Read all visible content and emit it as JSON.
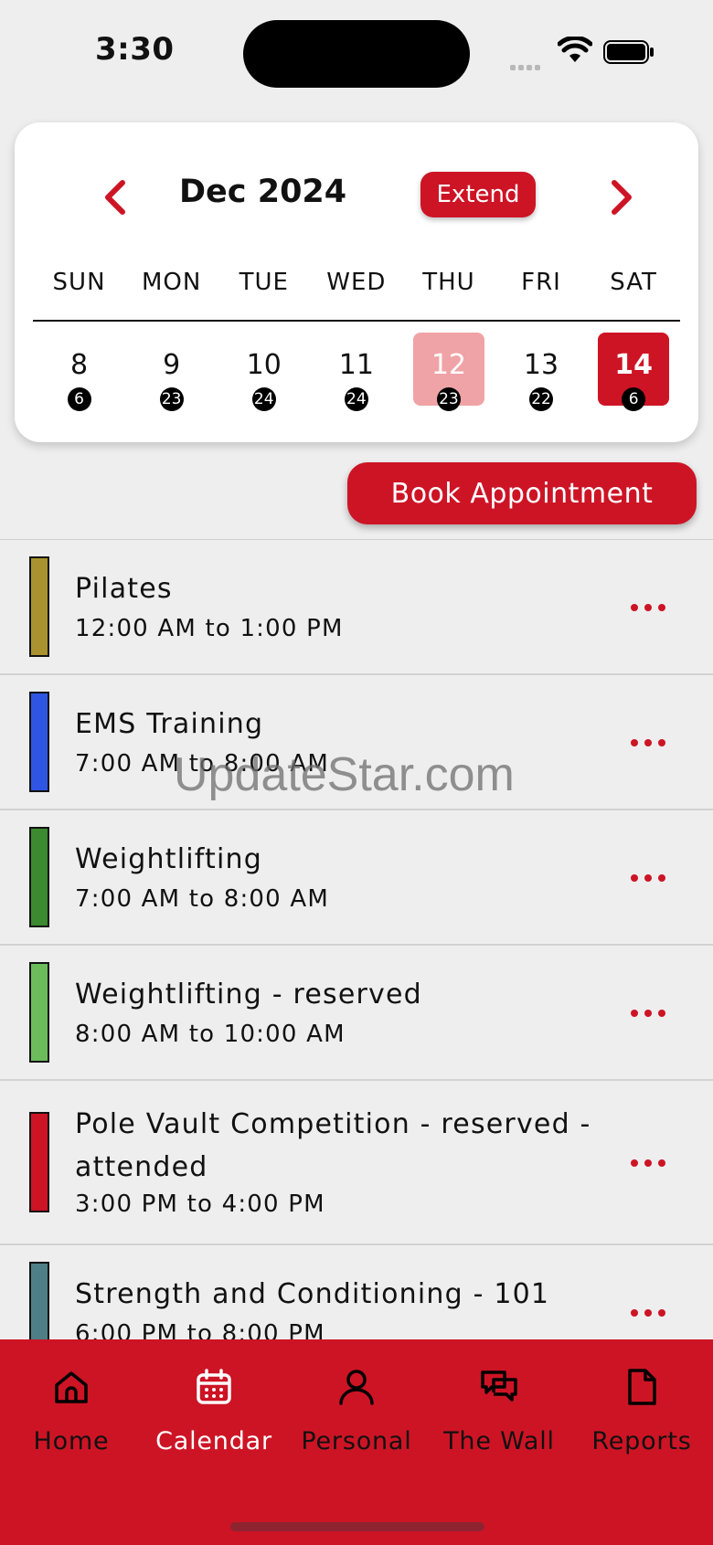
{
  "status_bar": {
    "time": "3:30"
  },
  "calendar": {
    "month_title": "Dec 2024",
    "extend_label": "Extend",
    "weekdays": [
      "SUN",
      "MON",
      "TUE",
      "WED",
      "THU",
      "FRI",
      "SAT"
    ],
    "days": [
      {
        "num": "8",
        "count": "6",
        "state": "normal"
      },
      {
        "num": "9",
        "count": "23",
        "state": "normal"
      },
      {
        "num": "10",
        "count": "24",
        "state": "normal"
      },
      {
        "num": "11",
        "count": "24",
        "state": "normal"
      },
      {
        "num": "12",
        "count": "23",
        "state": "today"
      },
      {
        "num": "13",
        "count": "22",
        "state": "normal"
      },
      {
        "num": "14",
        "count": "6",
        "state": "selected"
      }
    ],
    "colors": {
      "accent": "#cd1425",
      "today_highlight": "#f0a3a6"
    }
  },
  "book_button_label": "Book Appointment",
  "appointments": [
    {
      "title": "Pilates",
      "time": "12:00 AM to 1:00 PM",
      "color": "#a9922f"
    },
    {
      "title": "EMS Training",
      "time": "7:00 AM to 8:00 AM",
      "color": "#2f55e3"
    },
    {
      "title": "Weightlifting",
      "time": "7:00 AM to 8:00 AM",
      "color": "#3b8a30"
    },
    {
      "title": "Weightlifting - reserved",
      "time": "8:00 AM to 10:00 AM",
      "color": "#6cbc5c"
    },
    {
      "title": "Pole Vault Competition - reserved - attended",
      "time": "3:00 PM to 4:00 PM",
      "color": "#cd1425"
    },
    {
      "title": "Strength and Conditioning - 101",
      "time": "6:00 PM to 8:00 PM",
      "color": "#4f7f86"
    }
  ],
  "watermark": "UpdateStar.com",
  "tabs": [
    {
      "label": "Home",
      "icon": "home-icon"
    },
    {
      "label": "Calendar",
      "icon": "calendar-icon"
    },
    {
      "label": "Personal",
      "icon": "person-icon"
    },
    {
      "label": "The Wall",
      "icon": "chat-bubbles-icon"
    },
    {
      "label": "Reports",
      "icon": "document-icon"
    }
  ]
}
